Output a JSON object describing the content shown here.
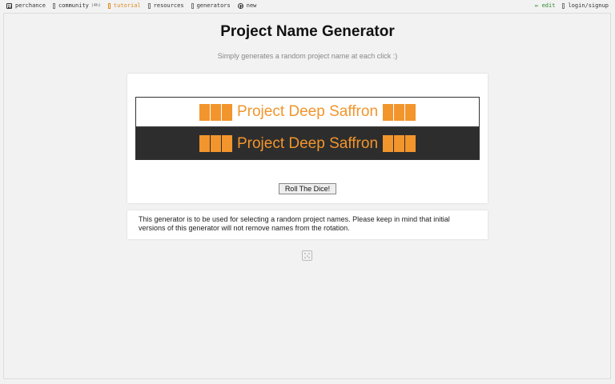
{
  "nav": {
    "left": [
      {
        "label": "perchance",
        "icon": "dice-icon"
      },
      {
        "label": "community",
        "suffix": "(4h)",
        "icon": "community-icon"
      },
      {
        "label": "tutorial",
        "icon": "tutorial-icon",
        "active": true
      },
      {
        "label": "resources",
        "icon": "resources-icon"
      },
      {
        "label": "generators",
        "icon": "generators-icon"
      },
      {
        "label": "new",
        "icon": "plus-circle-icon"
      }
    ],
    "right": [
      {
        "label": "edit",
        "icon": "pencil-icon"
      },
      {
        "label": "login/signup",
        "icon": "user-icon"
      }
    ]
  },
  "page": {
    "title": "Project Name Generator",
    "subtitle": "Simply generates a random project name at each click :)"
  },
  "result": {
    "name": "Project Deep Saffron"
  },
  "button": {
    "roll_label": "Roll The Dice!"
  },
  "info": {
    "text": "This generator is to be used for selecting a random project names. Please keep in mind that initial versions of this generator will not remove names from the rotation."
  },
  "colors": {
    "accent": "#f2952c",
    "dark_band": "#2d2d2d",
    "edit_green": "#2a8a2a"
  }
}
